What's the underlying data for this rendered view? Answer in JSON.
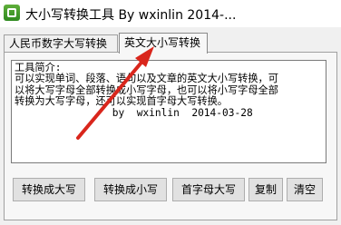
{
  "window": {
    "title": "大小写转换工具  By  wxinlin    2014-..."
  },
  "tabs": [
    {
      "label": "人民币数字大写转换"
    },
    {
      "label": "英文大小写转换"
    }
  ],
  "textarea": {
    "value": "工具简介:\n可以实现单词、段落、语句以及文章的英文大小写转换，可\n以将大写字母全部转换成小写字母，也可以将小写字母全部\n转换为大写字母，还可以实现首字母大写转换。\n                by  wxinlin  2014-03-28"
  },
  "buttons": {
    "to_upper": "转换成大写",
    "to_lower": "转换成小写",
    "capitalize": "首字母大写",
    "copy": "复制",
    "clear": "清空"
  },
  "colors": {
    "annotation_arrow": "#d9261c",
    "app_icon": "#3f9a2a"
  }
}
